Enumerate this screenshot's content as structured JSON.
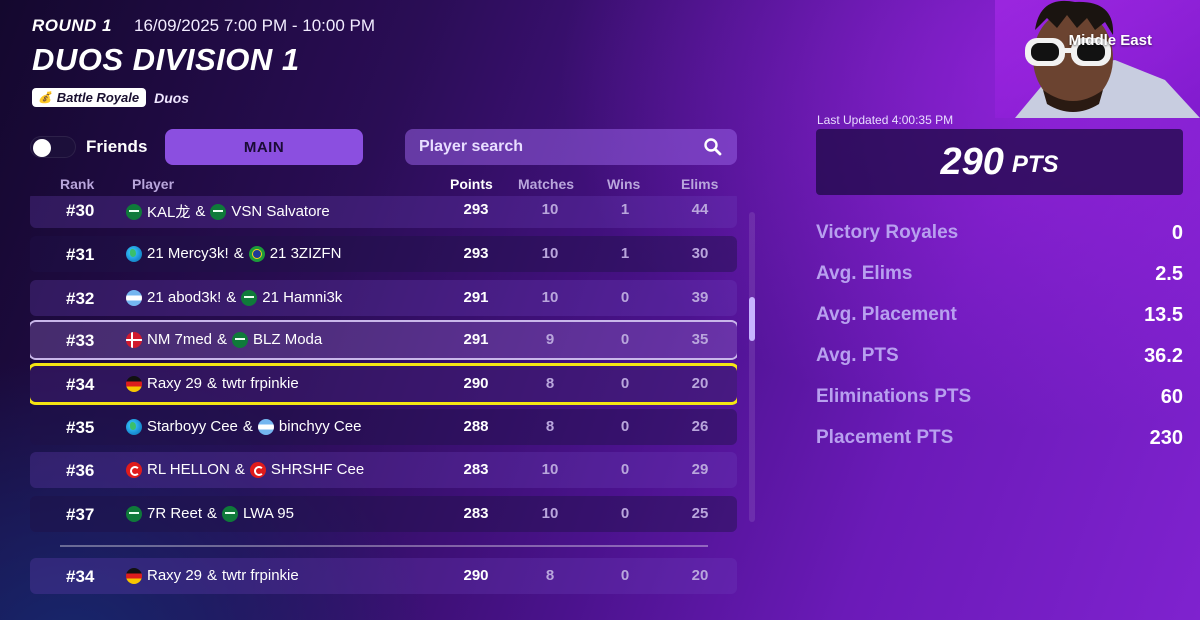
{
  "header": {
    "round": "ROUND 1",
    "date": "16/09/2025 7:00 PM - 10:00 PM",
    "title": "DUOS DIVISION 1",
    "mode_badge": "Battle Royale",
    "mode_type": "Duos"
  },
  "controls": {
    "friends_label": "Friends",
    "friends_toggle": "off",
    "main_tab": "MAIN",
    "search_placeholder": "Player search"
  },
  "columns": {
    "rank": "Rank",
    "player": "Player",
    "points": "Points",
    "matches": "Matches",
    "wins": "Wins",
    "elims": "Elims"
  },
  "rows": [
    {
      "rank": "#30",
      "p1": "KAL龙",
      "f1": "sa",
      "p2": "VSN Salvatore",
      "f2": "sa",
      "points": "293",
      "matches": "10",
      "wins": "1",
      "elims": "44"
    },
    {
      "rank": "#31",
      "p1": "21 Mercy3k!",
      "f1": "globe",
      "p2": "21 3ZIZFN",
      "f2": "br",
      "points": "293",
      "matches": "10",
      "wins": "1",
      "elims": "30"
    },
    {
      "rank": "#32",
      "p1": "21 abod3k!",
      "f1": "ar",
      "p2": "21 Hamni3k",
      "f2": "sa",
      "points": "291",
      "matches": "10",
      "wins": "0",
      "elims": "39"
    },
    {
      "rank": "#33",
      "p1": "NM 7med",
      "f1": "dk",
      "p2": "BLZ Moda",
      "f2": "sa",
      "points": "291",
      "matches": "9",
      "wins": "0",
      "elims": "35"
    },
    {
      "rank": "#34",
      "p1": "Raxy 29",
      "f1": "de",
      "p2": "twtr frpinkie",
      "f2": "",
      "points": "290",
      "matches": "8",
      "wins": "0",
      "elims": "20"
    },
    {
      "rank": "#35",
      "p1": "Starboyy Cee",
      "f1": "globe",
      "p2": "binchyy Cee",
      "f2": "ar",
      "points": "288",
      "matches": "8",
      "wins": "0",
      "elims": "26"
    },
    {
      "rank": "#36",
      "p1": "RL HELLON",
      "f1": "tr",
      "p2": "SHRSHF Cee",
      "f2": "tr",
      "points": "283",
      "matches": "10",
      "wins": "0",
      "elims": "29"
    },
    {
      "rank": "#37",
      "p1": "7R Reet",
      "f1": "sa",
      "p2": "LWA 95",
      "f2": "sa",
      "points": "283",
      "matches": "10",
      "wins": "0",
      "elims": "25"
    }
  ],
  "pinned": {
    "rank": "#34",
    "p1": "Raxy 29",
    "f1": "de",
    "p2": "twtr frpinkie",
    "f2": "",
    "points": "290",
    "matches": "8",
    "wins": "0",
    "elims": "20"
  },
  "panel": {
    "region": "Middle East",
    "last_updated": "Last Updated 4:00:35 PM",
    "points_value": "290",
    "points_unit": "PTS",
    "stats": [
      {
        "label": "Victory Royales",
        "value": "0"
      },
      {
        "label": "Avg. Elims",
        "value": "2.5"
      },
      {
        "label": "Avg. Placement",
        "value": "13.5"
      },
      {
        "label": "Avg. PTS",
        "value": "36.2"
      },
      {
        "label": "Eliminations PTS",
        "value": "60"
      },
      {
        "label": "Placement PTS",
        "value": "230"
      }
    ]
  },
  "colors": {
    "accent": "#8b4fe0",
    "highlight_yellow": "#f5e513",
    "stat_label": "#b8a0ef"
  }
}
